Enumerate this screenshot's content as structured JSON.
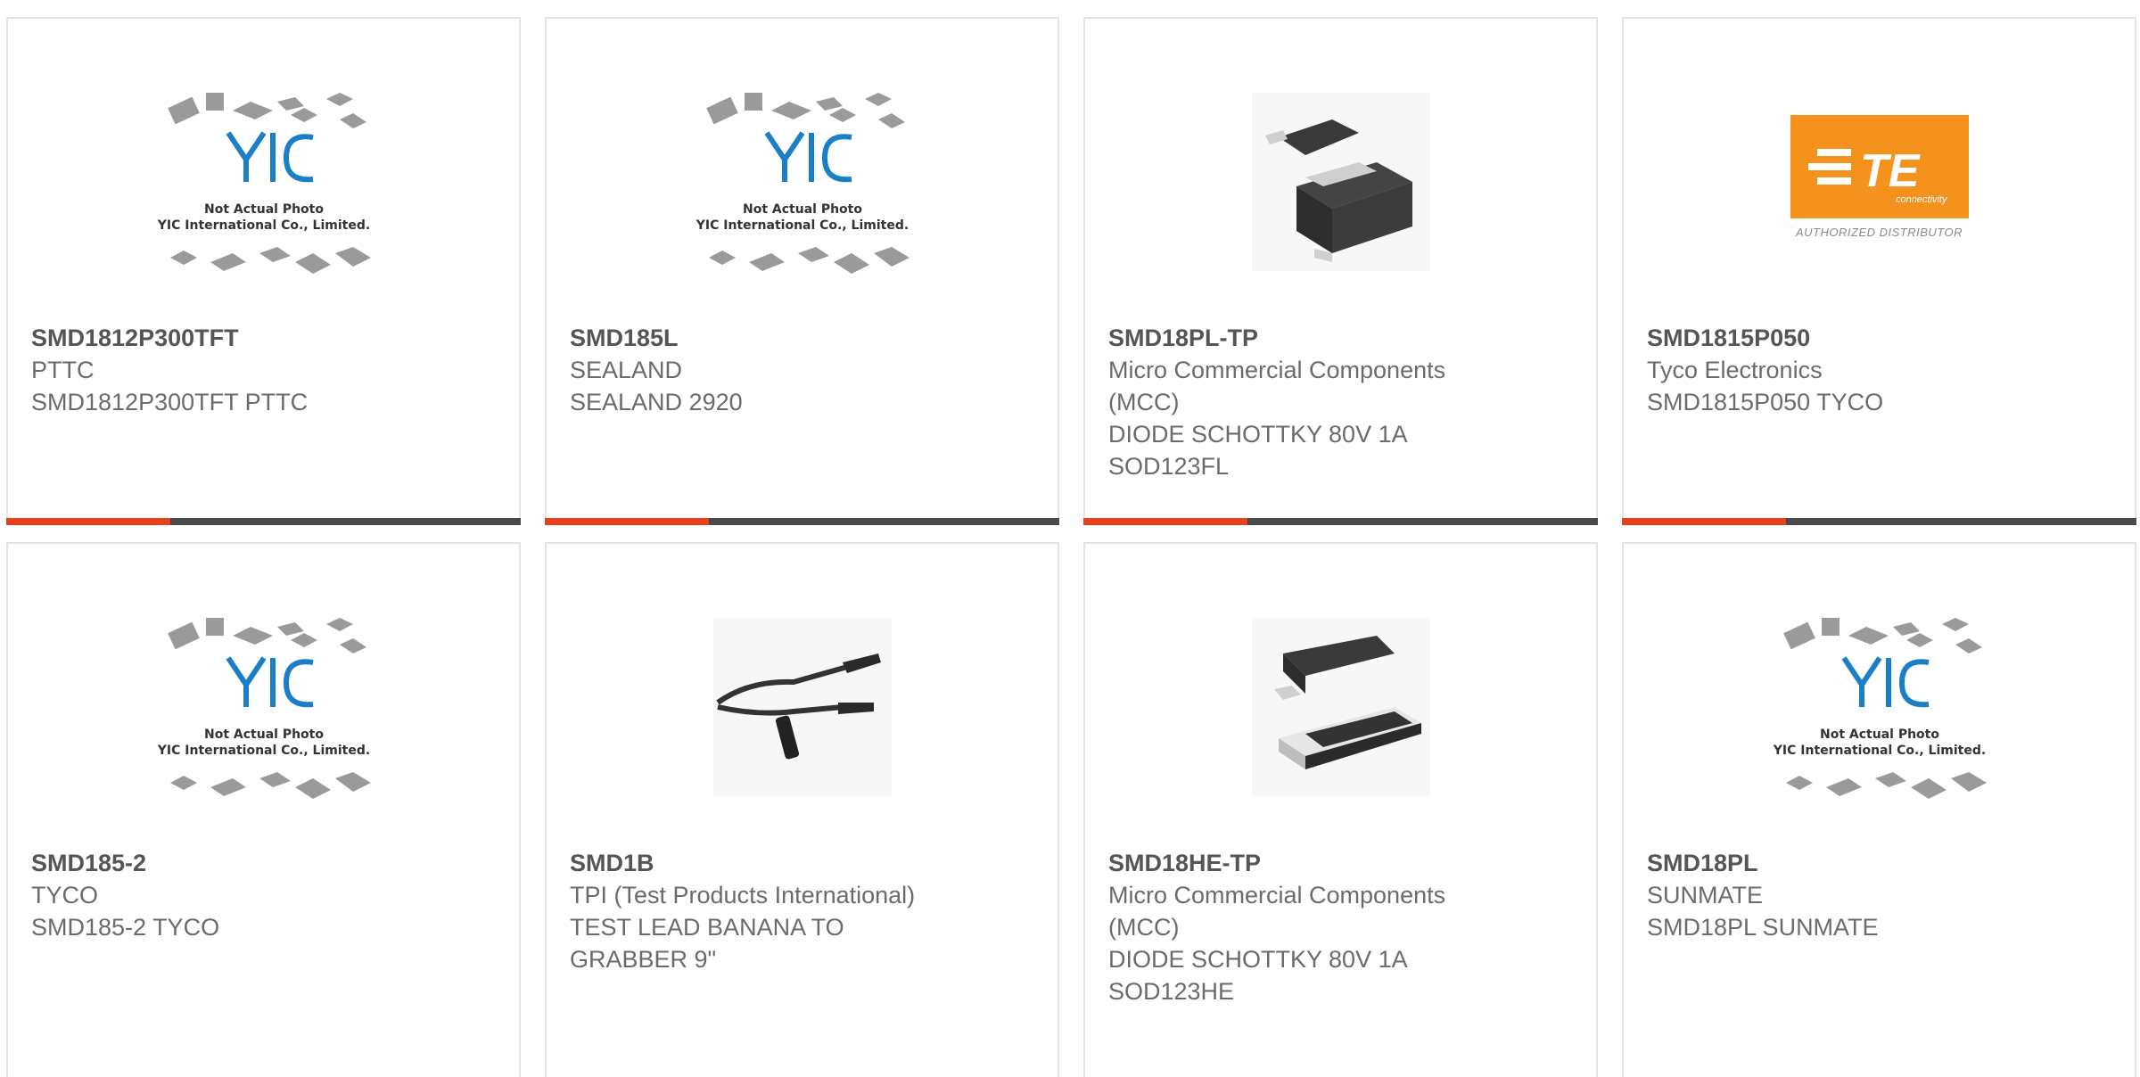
{
  "yic_note": {
    "line1": "Not Actual Photo",
    "line2": "YIC International Co., Limited."
  },
  "te_logo": {
    "brand": "TE",
    "tagline": "connectivity",
    "caption": "AUTHORIZED DISTRIBUTOR"
  },
  "colors": {
    "accent": "#e8401c",
    "bar": "#4a4a4a",
    "yic_blue": "#1a7fc6",
    "te_orange": "#f5921e"
  },
  "products": [
    {
      "part_number": "SMD1812P300TFT",
      "manufacturer": "PTTC",
      "description": "SMD1812P300TFT PTTC",
      "image": "yic-placeholder"
    },
    {
      "part_number": "SMD185L",
      "manufacturer": "SEALAND",
      "description": "SEALAND 2920",
      "image": "yic-placeholder"
    },
    {
      "part_number": "SMD18PL-TP",
      "manufacturer": "Micro Commercial Components (MCC)",
      "description": "DIODE SCHOTTKY 80V 1A SOD123FL",
      "image": "sod123fl-package"
    },
    {
      "part_number": "SMD1815P050",
      "manufacturer": "Tyco Electronics",
      "description": "SMD1815P050 TYCO",
      "image": "te-connectivity-logo"
    },
    {
      "part_number": "SMD185-2",
      "manufacturer": "TYCO",
      "description": "SMD185-2 TYCO",
      "image": "yic-placeholder"
    },
    {
      "part_number": "SMD1B",
      "manufacturer": "TPI (Test Products International)",
      "description": "TEST LEAD BANANA TO GRABBER 9\"",
      "image": "test-lead-photo"
    },
    {
      "part_number": "SMD18HE-TP",
      "manufacturer": "Micro Commercial Components (MCC)",
      "description": "DIODE SCHOTTKY 80V 1A SOD123HE",
      "image": "sod123he-package"
    },
    {
      "part_number": "SMD18PL",
      "manufacturer": "SUNMATE",
      "description": "SMD18PL SUNMATE",
      "image": "yic-placeholder"
    }
  ]
}
